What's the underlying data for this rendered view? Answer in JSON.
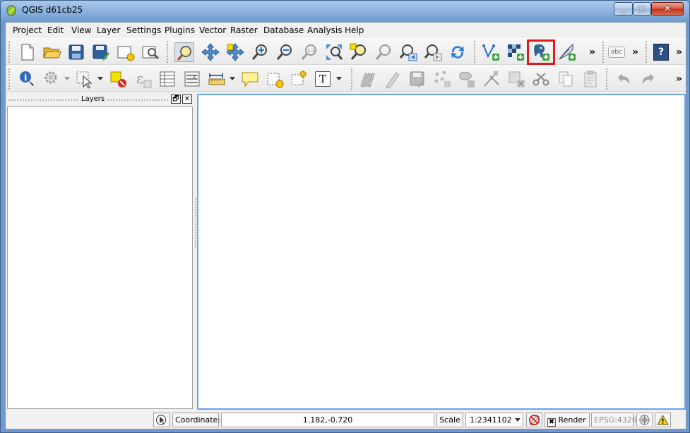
{
  "window": {
    "title": "QGIS d61cb25"
  },
  "menu": [
    "Project",
    "Edit",
    "View",
    "Layer",
    "Settings",
    "Plugins",
    "Vector",
    "Raster",
    "Database",
    "Analysis",
    "Help"
  ],
  "toolbar1": {
    "more_label": "»",
    "label_tool_text": "abc",
    "help_text": "?"
  },
  "toolbar2": {
    "more_label": "»",
    "label_tool_text": "T"
  },
  "layers_panel": {
    "title": "Layers",
    "float_label": "🗗",
    "close_label": "✕"
  },
  "statusbar": {
    "coordinate_label": "Coordinate:",
    "coordinate_value": "1.182,-0.720",
    "scale_label": "Scale",
    "scale_value": "1:2341102",
    "render_label": "Render",
    "crs_label": "EPSG:4326"
  },
  "colors": {
    "highlight": "#e01a1a",
    "canvas_border": "#6aa5e8",
    "add_green": "#3fa33f"
  }
}
